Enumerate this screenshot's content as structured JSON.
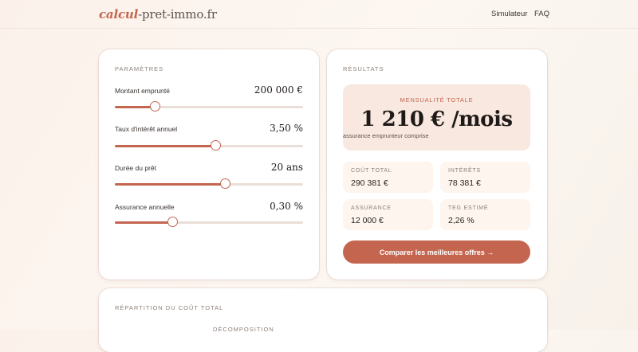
{
  "nav": {
    "logo_accent": "calcul",
    "logo_rest": "-pret-immo.fr",
    "links": [
      "Simulateur",
      "FAQ"
    ]
  },
  "params": {
    "title": "PARAMÈTRES",
    "items": [
      {
        "label": "Montant emprunté",
        "value": "200 000 €",
        "level": 0.218
      },
      {
        "label": "Taux d'intérêt annuel",
        "value": "3,50 %",
        "level": 0.54
      },
      {
        "label": "Durée du prêt",
        "value": "20 ans",
        "level": 0.59
      },
      {
        "label": "Assurance annuelle",
        "value": "0,30 %",
        "level": 0.31
      }
    ]
  },
  "results": {
    "title": "RÉSULTATS",
    "monthly_label": "MENSUALITÉ TOTALE",
    "monthly_value": "1 210 € /mois",
    "monthly_sub": "assurance emprunteur comprise",
    "stats": [
      {
        "label": "COÛT TOTAL",
        "value": "290 381 €"
      },
      {
        "label": "INTÉRÊTS",
        "value": "78 381 €"
      },
      {
        "label": "ASSURANCE",
        "value": "12 000 €"
      },
      {
        "label": "TEG ESTIMÉ",
        "value": "2,26 %"
      }
    ],
    "cta_label": "Comparer les meilleures offres →"
  },
  "breakdown": {
    "title": "RÉPARTITION DU COÛT TOTAL",
    "subtitle": "DÉCOMPOSITION"
  },
  "colors": {
    "accent": "#c4664f",
    "panel": "#f8e8df",
    "stat_bg": "#fdf5ee"
  }
}
